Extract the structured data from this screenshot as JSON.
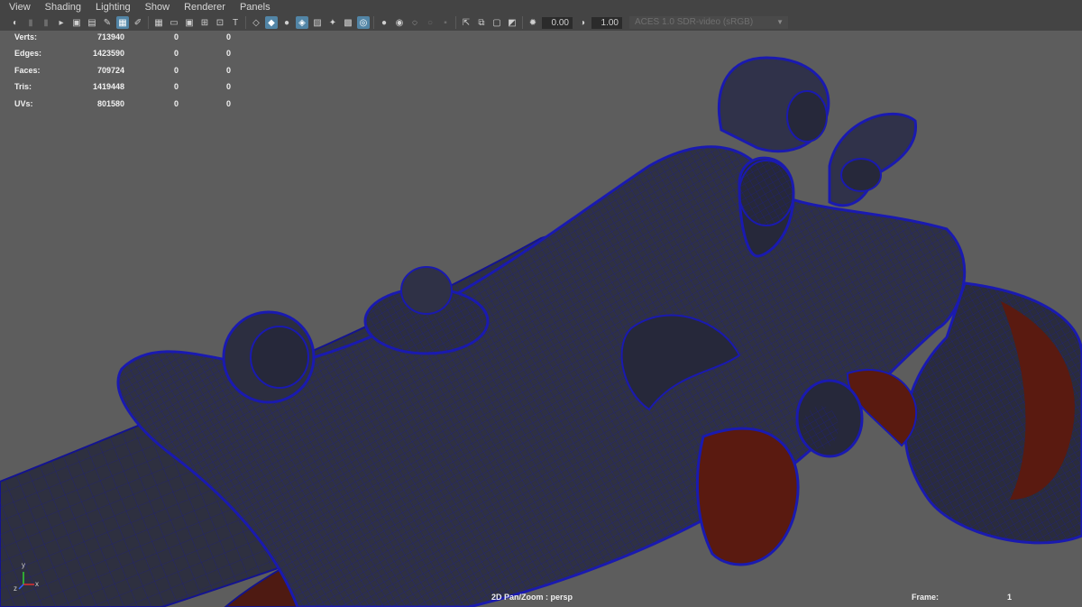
{
  "menu": [
    "View",
    "Shading",
    "Lighting",
    "Show",
    "Renderer",
    "Panels"
  ],
  "toolbar": {
    "exposure": "0.00",
    "gamma": "1.00",
    "colorspace": "ACES 1.0 SDR-video (sRGB)",
    "groups": [
      [
        {
          "icon": "camera-select-icon",
          "on": false
        },
        {
          "icon": "lock-camera-icon",
          "on": false,
          "dim": true
        },
        {
          "icon": "camera-attributes-icon",
          "on": false,
          "dim": true
        },
        {
          "icon": "bookmark-icon",
          "on": false
        },
        {
          "icon": "image-plane-icon",
          "on": false
        },
        {
          "icon": "2d-pan-zoom-icon",
          "on": false
        },
        {
          "icon": "grease-pencil-icon",
          "on": false
        },
        {
          "icon": "grid-icon",
          "on": true
        },
        {
          "icon": "film-gate-icon",
          "on": false
        }
      ],
      [
        {
          "icon": "grid-toggle-icon",
          "on": false
        },
        {
          "icon": "resolution-gate-icon",
          "on": false
        },
        {
          "icon": "gate-mask-icon",
          "on": false
        },
        {
          "icon": "field-chart-icon",
          "on": false
        },
        {
          "icon": "safe-action-icon",
          "on": false
        },
        {
          "icon": "safe-title-icon",
          "on": false
        }
      ],
      [
        {
          "icon": "wireframe-icon",
          "on": false
        },
        {
          "icon": "smooth-shade-icon",
          "on": true
        },
        {
          "icon": "default-material-icon",
          "on": false
        },
        {
          "icon": "wireframe-on-shaded-icon",
          "on": true
        },
        {
          "icon": "xray-icon",
          "on": false
        },
        {
          "icon": "use-lights-icon",
          "on": false
        },
        {
          "icon": "textured-icon",
          "on": false
        },
        {
          "icon": "isolate-icon",
          "on": true
        }
      ],
      [
        {
          "icon": "shadows-icon",
          "on": false
        },
        {
          "icon": "screen-space-ao-icon",
          "on": false
        },
        {
          "icon": "motion-blur-icon",
          "on": false
        },
        {
          "icon": "antialias-icon",
          "on": false,
          "dim": true
        },
        {
          "icon": "depth-of-field-icon",
          "on": false,
          "dim": true
        }
      ],
      [
        {
          "icon": "xray-joints-icon",
          "on": false
        },
        {
          "icon": "isolate-select-icon",
          "on": false
        },
        {
          "icon": "xray-active-icon",
          "on": false
        },
        {
          "icon": "backface-culling-icon",
          "on": false
        }
      ]
    ]
  },
  "hud": {
    "rows": [
      {
        "label": "Verts:",
        "v1": "713940",
        "v2": "0",
        "v3": "0"
      },
      {
        "label": "Edges:",
        "v1": "1423590",
        "v2": "0",
        "v3": "0"
      },
      {
        "label": "Faces:",
        "v1": "709724",
        "v2": "0",
        "v3": "0"
      },
      {
        "label": "Tris:",
        "v1": "1419448",
        "v2": "0",
        "v3": "0"
      },
      {
        "label": "UVs:",
        "v1": "801580",
        "v2": "0",
        "v3": "0"
      }
    ]
  },
  "camera_label": "2D Pan/Zoom : persp",
  "frame": {
    "label": "Frame:",
    "value": "1"
  },
  "axis": {
    "x": "x",
    "y": "y",
    "z": "z",
    "x_color": "#e03030",
    "y_color": "#30d030",
    "z_color": "#3060ff"
  },
  "colors": {
    "background": "#5d5d5d",
    "mesh": "#2f3142",
    "wire": "#1e1ea8",
    "wood": "#5a1a10"
  }
}
